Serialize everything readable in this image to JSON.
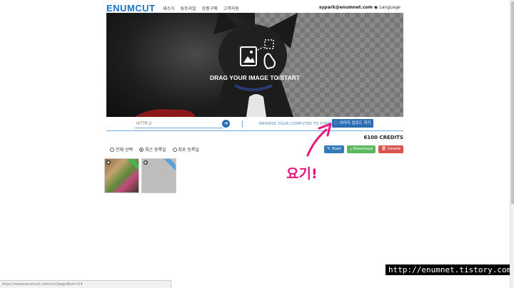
{
  "header": {
    "logo": "ENUMCUT",
    "nav": [
      "새소식",
      "튜토리얼",
      "상품구매",
      "고객지원"
    ],
    "account": "sypark@enumnet.com ▾",
    "language": "Language"
  },
  "hero": {
    "drag_text": "DRAG YOUR IMAGE TO START"
  },
  "upload": {
    "url_placeholder": "HTTP://",
    "browse_text": "BROWSE YOUR COMPUTER TO START",
    "upload_button": "이미지 업로드 하기"
  },
  "credits": "6100 CREDITS",
  "filters": [
    {
      "label": "전체 선택",
      "selected": false
    },
    {
      "label": "최근 등록일",
      "selected": true
    },
    {
      "label": "최초 등록일",
      "selected": false
    }
  ],
  "actions": {
    "start": "Start",
    "download": "Download",
    "delete": "Delete"
  },
  "annotation": "요기!",
  "status_url": "https://www.enumcut.com/cut?pageNum=14",
  "watermark": "http://enumnet.tistory.com",
  "colors": {
    "brand": "#1a73c9",
    "start": "#337ab7",
    "download": "#5cb85c",
    "delete": "#d9534f",
    "annotation": "#e8157e"
  }
}
